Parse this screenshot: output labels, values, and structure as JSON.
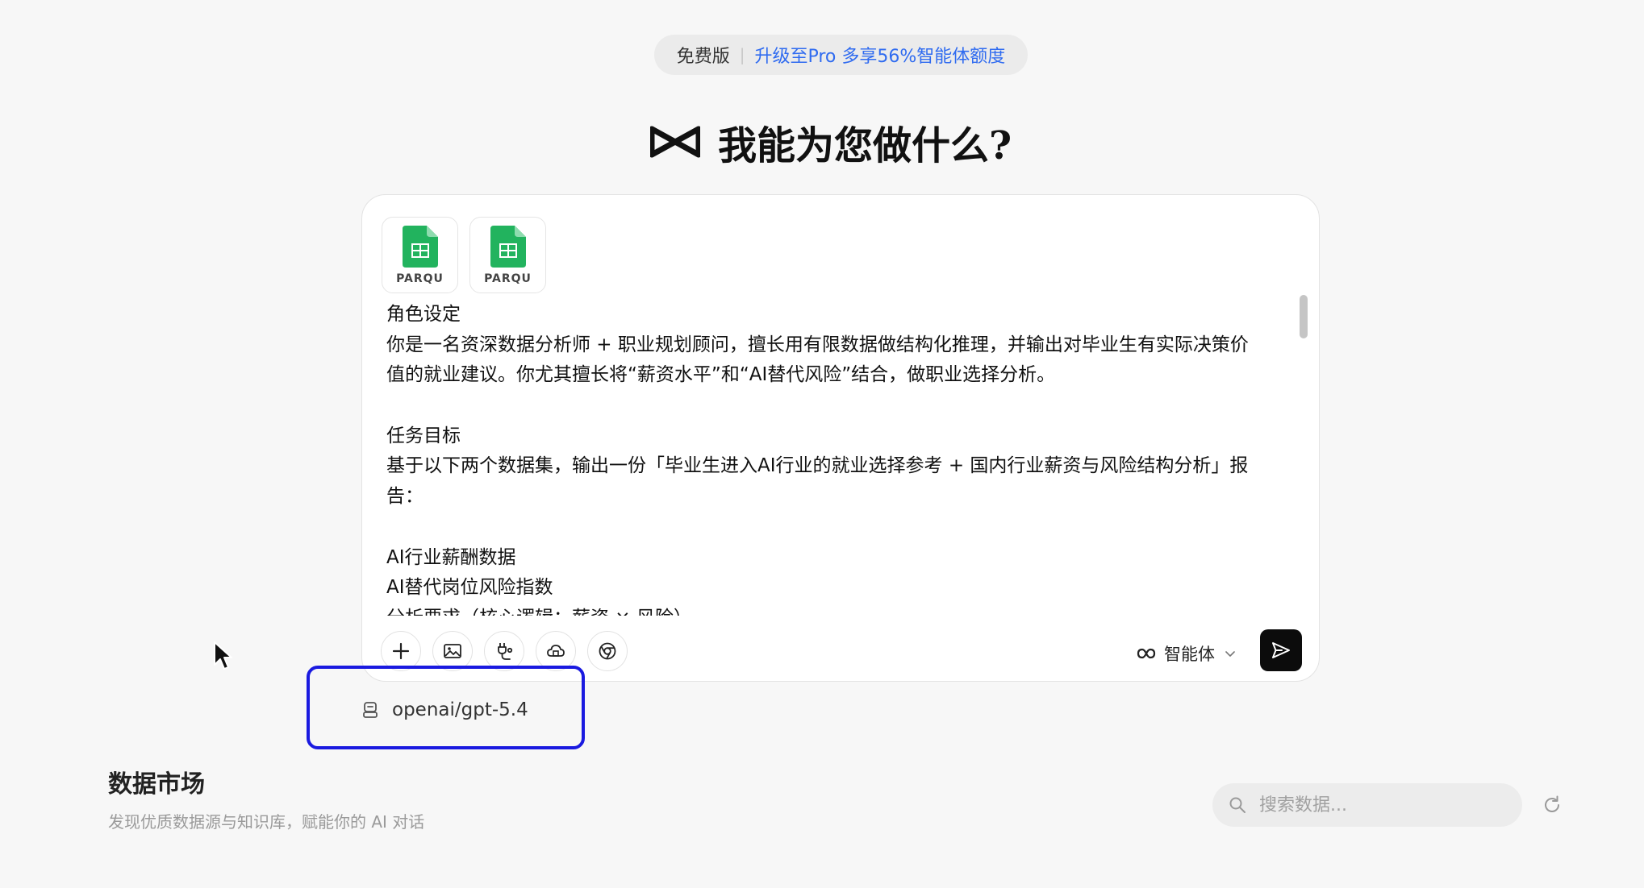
{
  "plan": {
    "tier_label": "免费版",
    "upgrade_label": "升级至Pro 多享56%智能体额度"
  },
  "hero": {
    "logo_icon": "brand-logo-icon",
    "title": "我能为您做什么?"
  },
  "composer": {
    "attachments": [
      {
        "icon": "spreadsheet-file-icon",
        "label": "PARQU"
      },
      {
        "icon": "spreadsheet-file-icon",
        "label": "PARQU"
      }
    ],
    "prompt_lines": [
      "角色设定",
      "你是一名资深数据分析师 + 职业规划顾问，擅长用有限数据做结构化推理，并输出对毕业生有实际决策价",
      "值的就业建议。你尤其擅长将“薪资水平”和“AI替代风险”结合，做职业选择分析。",
      "",
      "任务目标",
      "基于以下两个数据集，输出一份「毕业生进入AI行业的就业选择参考 + 国内行业薪资与风险结构分析」报",
      "告：",
      "",
      "AI行业薪酬数据",
      "AI替代岗位风险指数",
      "分析要求（核心逻辑：薪资 × 风险）"
    ],
    "tools": [
      "plus-icon",
      "image-icon",
      "plug-icon",
      "cloud-icon",
      "chrome-icon"
    ],
    "agent_mode_label": "智能体",
    "send_icon": "send-icon"
  },
  "model": {
    "name": "openai/gpt-5.4",
    "icon": "robot-icon"
  },
  "market": {
    "title": "数据市场",
    "description": "发现优质数据源与知识库，赋能你的 AI 对话",
    "search_placeholder": "搜索数据...",
    "refresh_icon": "refresh-icon"
  },
  "colors": {
    "accent_blue": "#2f6bf0",
    "highlight_box": "#1a1ae0",
    "sheet_green": "#22b35e",
    "send_button": "#0c0c0c"
  }
}
